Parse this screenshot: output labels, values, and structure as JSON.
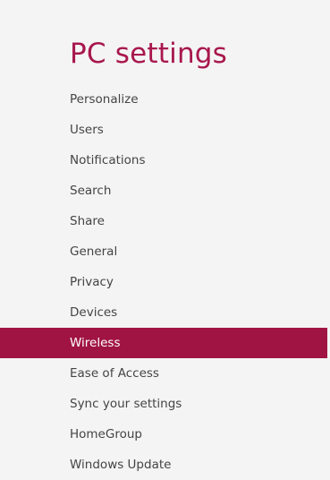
{
  "header": {
    "title": "PC settings"
  },
  "nav": {
    "selected_index": 8,
    "items": [
      {
        "id": "personalize",
        "label": "Personalize"
      },
      {
        "id": "users",
        "label": "Users"
      },
      {
        "id": "notifications",
        "label": "Notifications"
      },
      {
        "id": "search",
        "label": "Search"
      },
      {
        "id": "share",
        "label": "Share"
      },
      {
        "id": "general",
        "label": "General"
      },
      {
        "id": "privacy",
        "label": "Privacy"
      },
      {
        "id": "devices",
        "label": "Devices"
      },
      {
        "id": "wireless",
        "label": "Wireless"
      },
      {
        "id": "ease-of-access",
        "label": "Ease of Access"
      },
      {
        "id": "sync-your-settings",
        "label": "Sync your settings"
      },
      {
        "id": "homegroup",
        "label": "HomeGroup"
      },
      {
        "id": "windows-update",
        "label": "Windows Update"
      }
    ]
  },
  "colors": {
    "accent": "#a8174d",
    "selected_bg": "#a01443",
    "background": "#f4f4f4",
    "text": "#444444"
  }
}
